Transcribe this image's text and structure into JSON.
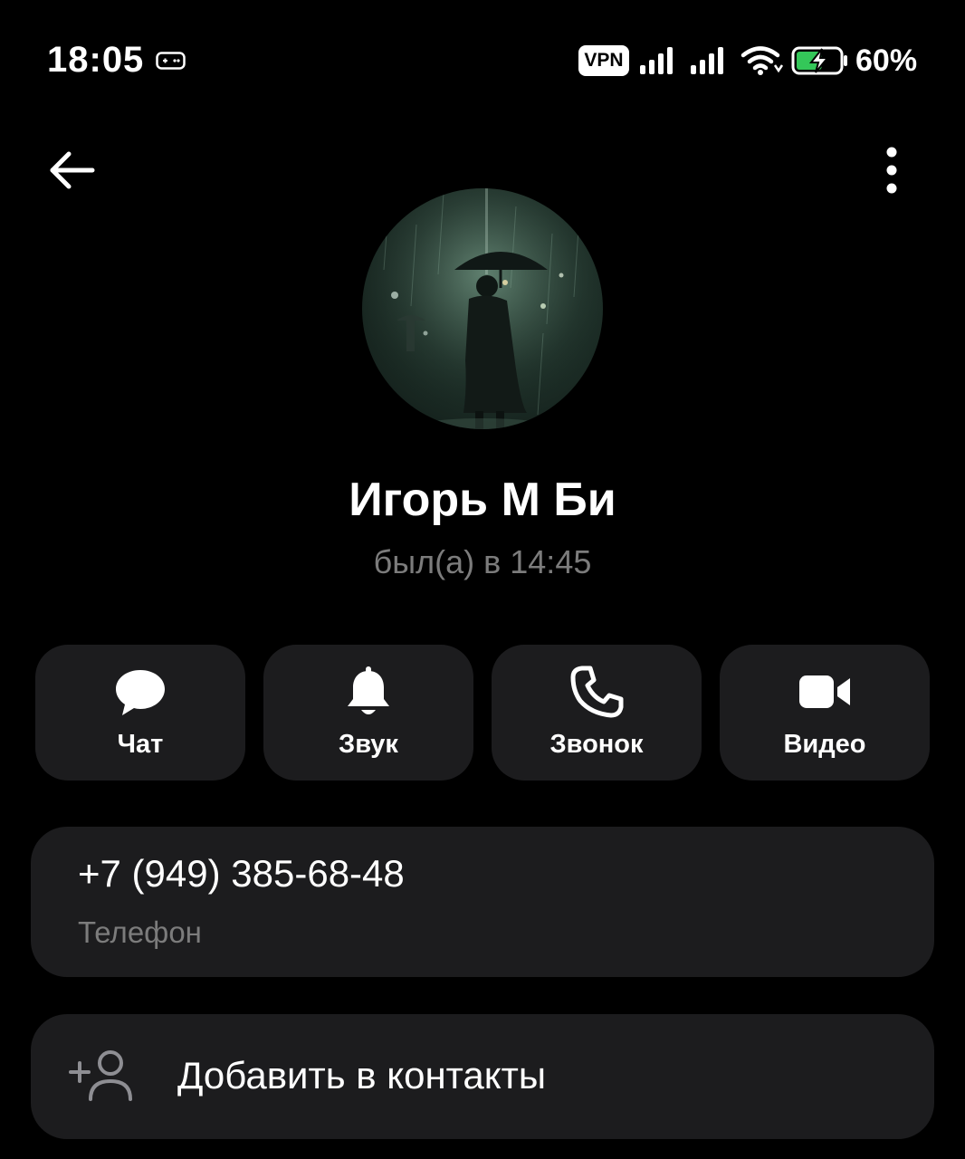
{
  "status_bar": {
    "time": "18:05",
    "vpn_label": "VPN",
    "battery_percent": "60%",
    "battery_level": 0.6,
    "icons": [
      "gamepad-icon",
      "signal-icon",
      "signal-icon",
      "wifi-icon",
      "battery-charging-icon"
    ]
  },
  "top_bar": {
    "back_icon": "arrow-left-icon",
    "menu_icon": "more-vertical-icon"
  },
  "profile": {
    "name": "Игорь М Би",
    "status": "был(а) в 14:45"
  },
  "actions": [
    {
      "label": "Чат",
      "icon": "chat-bubble-icon"
    },
    {
      "label": "Звук",
      "icon": "bell-icon"
    },
    {
      "label": "Звонок",
      "icon": "phone-icon"
    },
    {
      "label": "Видео",
      "icon": "video-camera-icon"
    }
  ],
  "phone": {
    "number": "+7 (949) 385-68-48",
    "label": "Телефон"
  },
  "add_contact": {
    "label": "Добавить в контакты",
    "icon": "add-user-icon"
  },
  "colors": {
    "background": "#000000",
    "card": "#1c1c1e",
    "secondary_text": "#7c7c7c",
    "battery_fill": "#34c759"
  }
}
